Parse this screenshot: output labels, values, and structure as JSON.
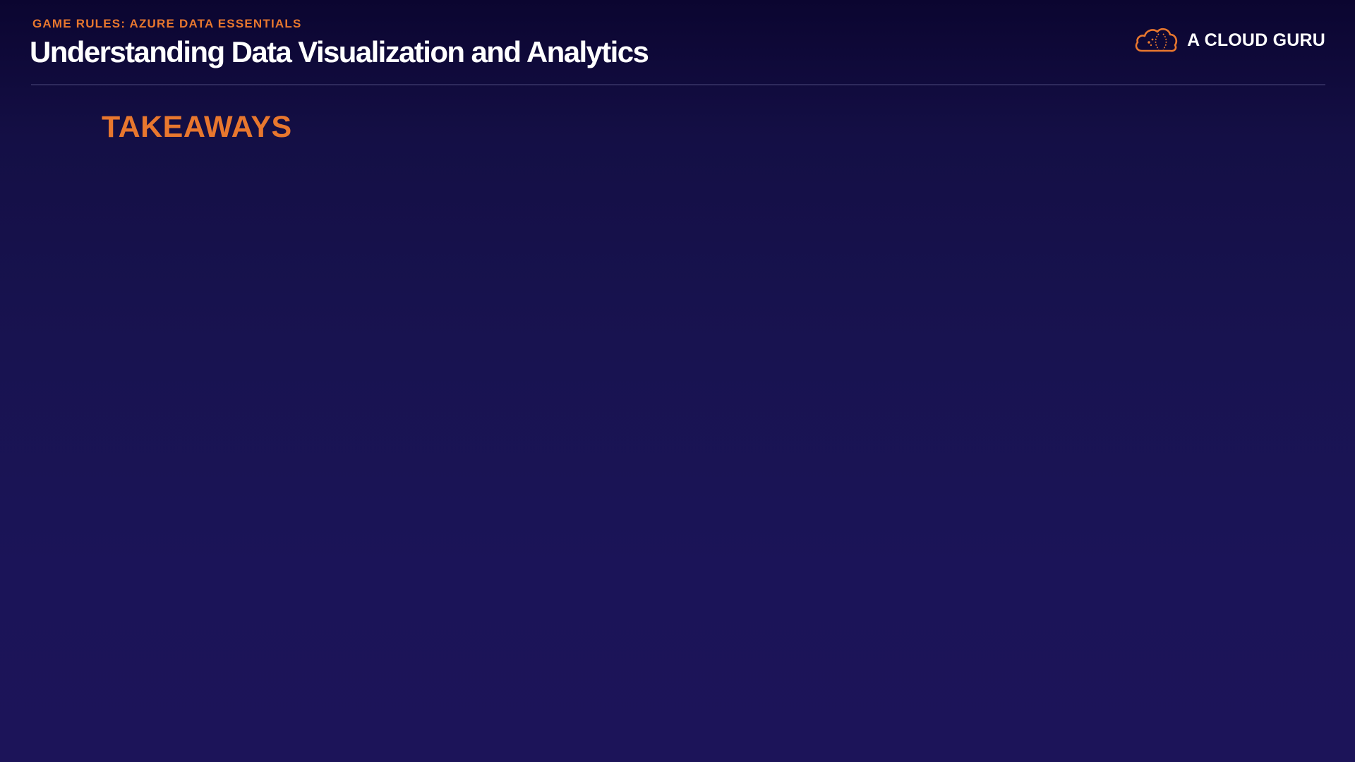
{
  "header": {
    "eyebrow": "GAME RULES: AZURE DATA ESSENTIALS",
    "title": "Understanding Data Visualization and Analytics"
  },
  "brand": {
    "name": "A CLOUD GURU",
    "logo_icon": "cloud-logo-icon"
  },
  "content": {
    "section_heading": "TAKEAWAYS"
  },
  "colors": {
    "accent": "#e8772e",
    "background": "#1b1458",
    "title_text": "#ffffff"
  }
}
